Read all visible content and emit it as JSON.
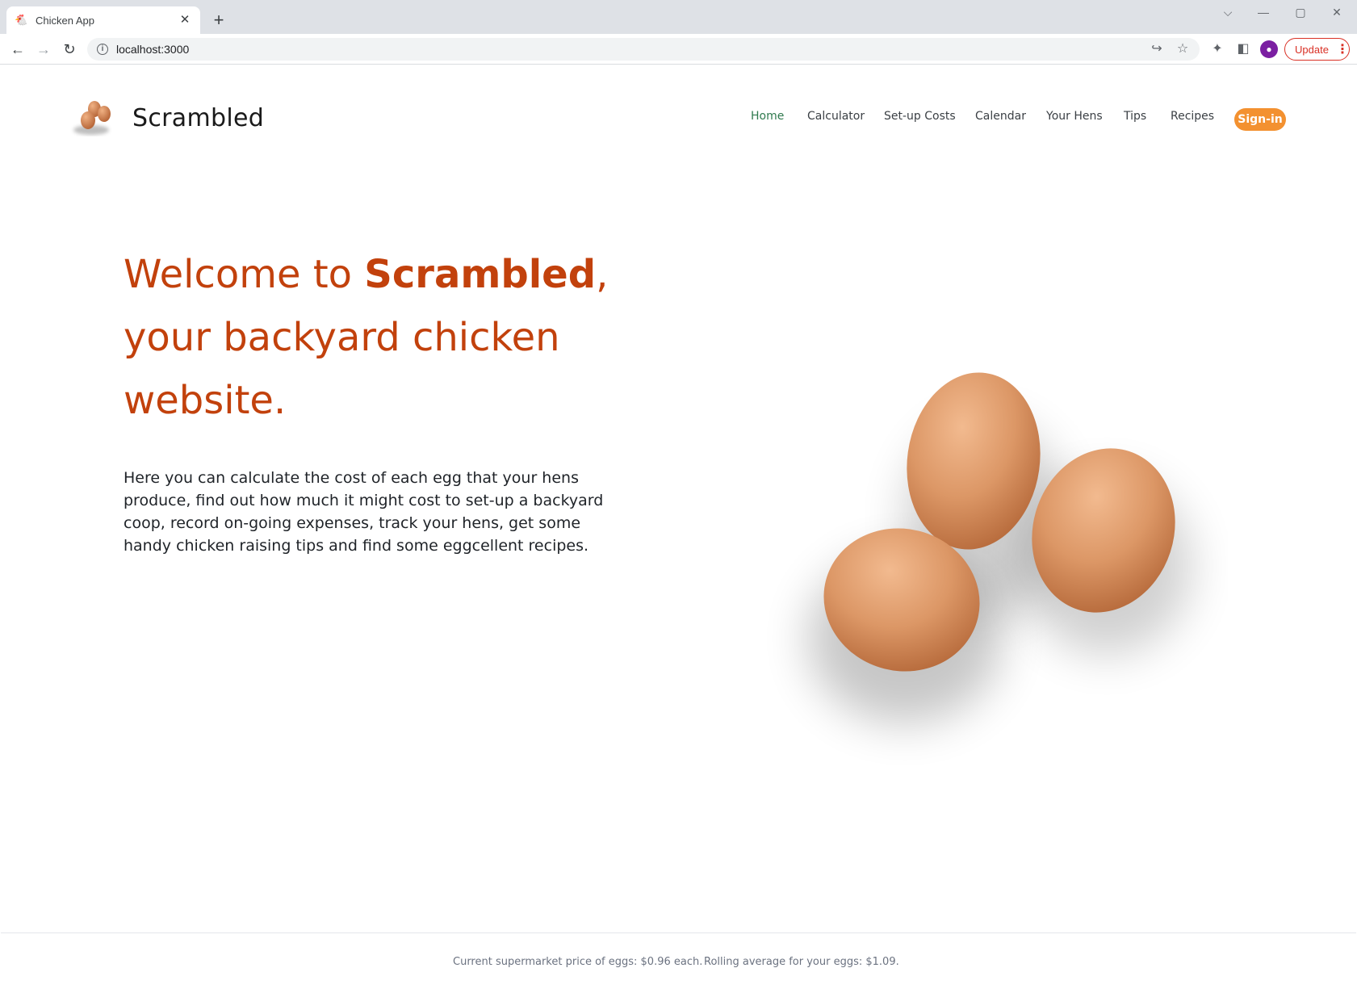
{
  "browser": {
    "tab_title": "Chicken App",
    "url": "localhost:3000",
    "update_label": "Update",
    "icons": [
      "chicken-favicon",
      "close-icon",
      "plus-icon",
      "chevron-down-icon",
      "minimize-icon",
      "maximize-icon",
      "close-window-icon",
      "back-icon",
      "forward-icon",
      "reload-icon",
      "info-icon",
      "share-icon",
      "star-icon",
      "extensions-icon",
      "sidepanel-icon",
      "profile-avatar",
      "kebab-icon"
    ]
  },
  "header": {
    "brand": "Scrambled",
    "nav": [
      "Home",
      "Calculator",
      "Set-up Costs",
      "Calendar",
      "Your Hens",
      "Tips",
      "Recipes"
    ],
    "active_nav": "Home",
    "signin_label": "Sign-in"
  },
  "hero": {
    "line1_prefix": "Welcome to ",
    "line1_strong": "Scrambled",
    "line1_suffix": ",",
    "line2": "your backyard chicken",
    "line3": "website.",
    "intro": "Here you can calculate the cost of each egg that your hens produce, find out how much it might cost to set-up a backyard coop, record on-going expenses, track your hens, get some handy chicken raising tips and find some eggcellent recipes."
  },
  "footer": {
    "supermarket": "Current supermarket price of eggs: $0.96 each.",
    "rolling": "Rolling average for your eggs: $1.09."
  },
  "colors": {
    "heading": "#c2410c",
    "nav_active": "#2f7a4e",
    "signin_bg": "#f39130",
    "update_red": "#d93025"
  }
}
